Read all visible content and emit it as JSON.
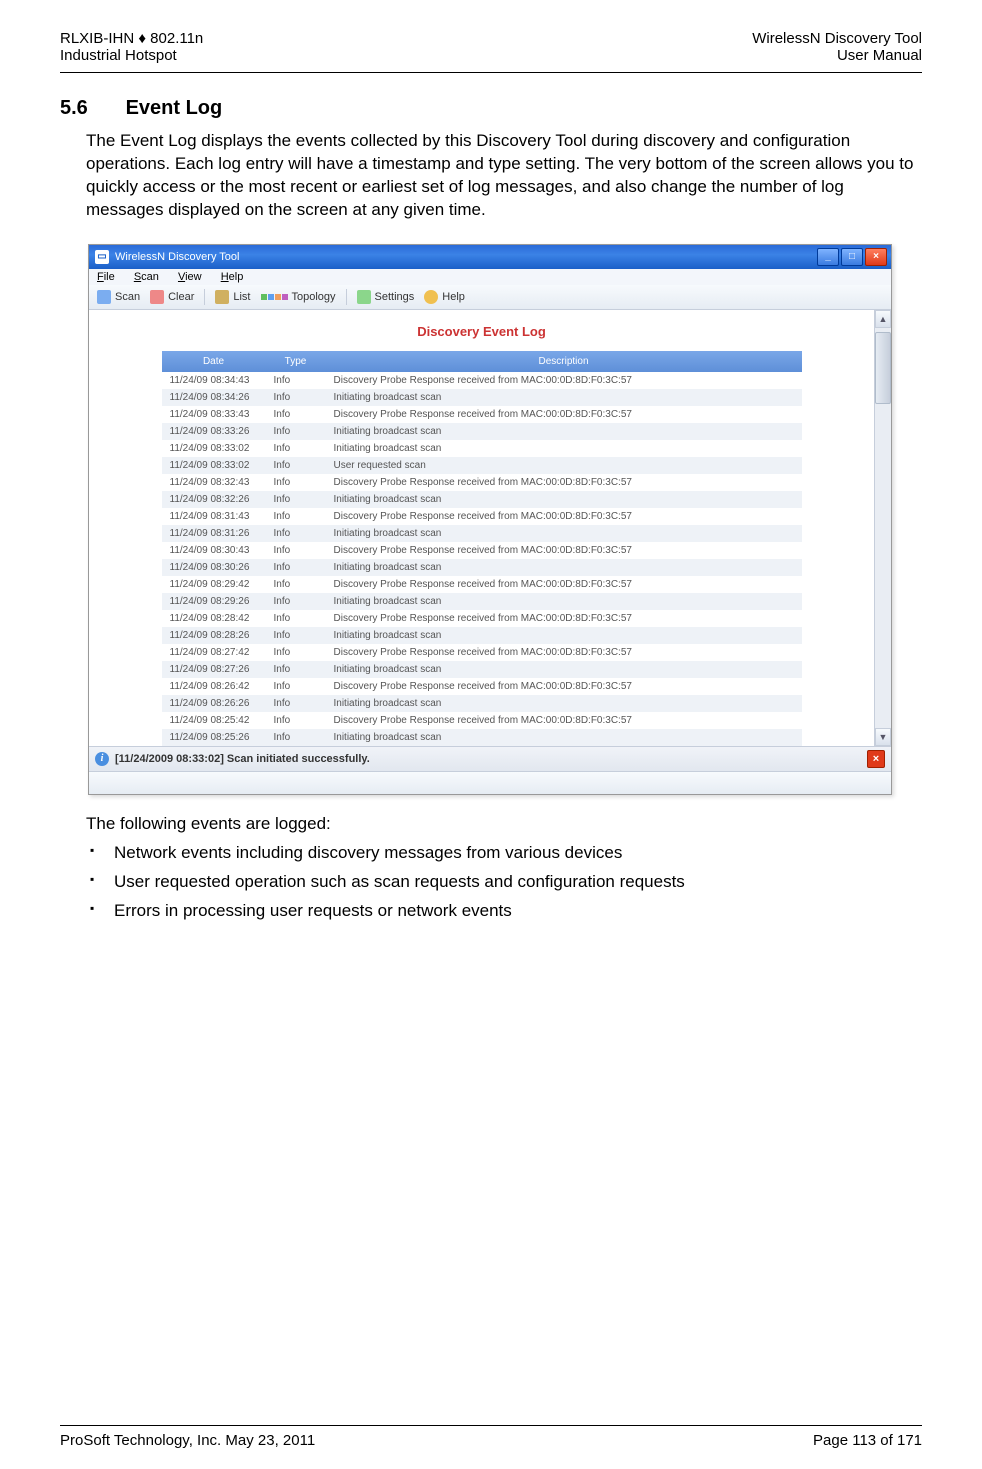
{
  "header": {
    "left1": "RLXIB-IHN ♦ 802.11n",
    "left2": "Industrial Hotspot",
    "right1": "WirelessN Discovery Tool",
    "right2": "User Manual"
  },
  "section": {
    "number": "5.6",
    "title": "Event Log"
  },
  "paragraph1": "The Event Log displays the events collected by this Discovery Tool during discovery and configuration operations. Each log entry will have a timestamp and type setting. The very bottom of the screen allows you to quickly access or the most recent or earliest set of log messages, and also change the number of log messages displayed on the screen at any given time.",
  "screenshot": {
    "title": "WirelessN Discovery Tool",
    "menu": {
      "file": "File",
      "scan": "Scan",
      "view": "View",
      "help": "Help"
    },
    "toolbar": {
      "scan": "Scan",
      "clear": "Clear",
      "list": "List",
      "topology": "Topology",
      "settings": "Settings",
      "help": "Help"
    },
    "log_title": "Discovery Event Log",
    "columns": {
      "date": "Date",
      "type": "Type",
      "desc": "Description"
    },
    "rows": [
      {
        "date": "11/24/09 08:34:43",
        "type": "Info",
        "desc": "Discovery Probe Response received from MAC:00:0D:8D:F0:3C:57"
      },
      {
        "date": "11/24/09 08:34:26",
        "type": "Info",
        "desc": "Initiating broadcast scan"
      },
      {
        "date": "11/24/09 08:33:43",
        "type": "Info",
        "desc": "Discovery Probe Response received from MAC:00:0D:8D:F0:3C:57"
      },
      {
        "date": "11/24/09 08:33:26",
        "type": "Info",
        "desc": "Initiating broadcast scan"
      },
      {
        "date": "11/24/09 08:33:02",
        "type": "Info",
        "desc": "Initiating broadcast scan"
      },
      {
        "date": "11/24/09 08:33:02",
        "type": "Info",
        "desc": "User requested scan"
      },
      {
        "date": "11/24/09 08:32:43",
        "type": "Info",
        "desc": "Discovery Probe Response received from MAC:00:0D:8D:F0:3C:57"
      },
      {
        "date": "11/24/09 08:32:26",
        "type": "Info",
        "desc": "Initiating broadcast scan"
      },
      {
        "date": "11/24/09 08:31:43",
        "type": "Info",
        "desc": "Discovery Probe Response received from MAC:00:0D:8D:F0:3C:57"
      },
      {
        "date": "11/24/09 08:31:26",
        "type": "Info",
        "desc": "Initiating broadcast scan"
      },
      {
        "date": "11/24/09 08:30:43",
        "type": "Info",
        "desc": "Discovery Probe Response received from MAC:00:0D:8D:F0:3C:57"
      },
      {
        "date": "11/24/09 08:30:26",
        "type": "Info",
        "desc": "Initiating broadcast scan"
      },
      {
        "date": "11/24/09 08:29:42",
        "type": "Info",
        "desc": "Discovery Probe Response received from MAC:00:0D:8D:F0:3C:57"
      },
      {
        "date": "11/24/09 08:29:26",
        "type": "Info",
        "desc": "Initiating broadcast scan"
      },
      {
        "date": "11/24/09 08:28:42",
        "type": "Info",
        "desc": "Discovery Probe Response received from MAC:00:0D:8D:F0:3C:57"
      },
      {
        "date": "11/24/09 08:28:26",
        "type": "Info",
        "desc": "Initiating broadcast scan"
      },
      {
        "date": "11/24/09 08:27:42",
        "type": "Info",
        "desc": "Discovery Probe Response received from MAC:00:0D:8D:F0:3C:57"
      },
      {
        "date": "11/24/09 08:27:26",
        "type": "Info",
        "desc": "Initiating broadcast scan"
      },
      {
        "date": "11/24/09 08:26:42",
        "type": "Info",
        "desc": "Discovery Probe Response received from MAC:00:0D:8D:F0:3C:57"
      },
      {
        "date": "11/24/09 08:26:26",
        "type": "Info",
        "desc": "Initiating broadcast scan"
      },
      {
        "date": "11/24/09 08:25:42",
        "type": "Info",
        "desc": "Discovery Probe Response received from MAC:00:0D:8D:F0:3C:57"
      },
      {
        "date": "11/24/09 08:25:26",
        "type": "Info",
        "desc": "Initiating broadcast scan"
      }
    ],
    "status": "[11/24/2009 08:33:02] Scan initiated successfully."
  },
  "paragraph2": "The following events are logged:",
  "bullets": [
    "Network events including discovery messages from various devices",
    "User requested operation such as scan requests and configuration requests",
    "Errors in processing user requests or network events"
  ],
  "footer": {
    "left1": "ProSoft Technology, Inc.",
    "left2": "May 23, 2011",
    "right": "Page 113 of 171"
  }
}
